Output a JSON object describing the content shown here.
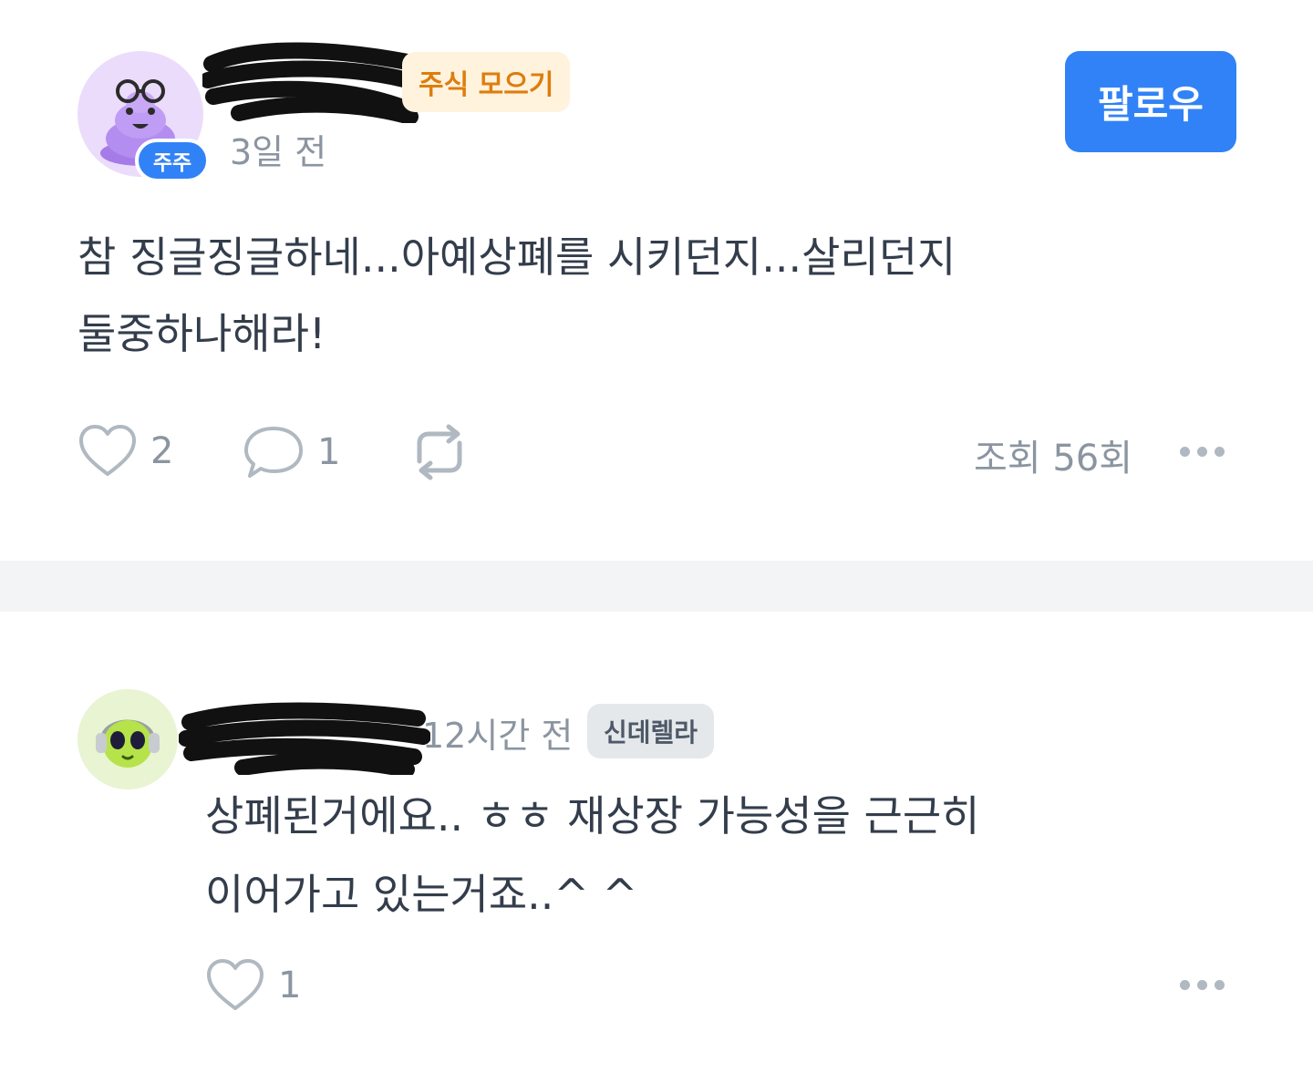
{
  "post": {
    "author": {
      "level_badge": "주주",
      "tag": "주식 모으기"
    },
    "time": "3일 전",
    "follow_label": "팔로우",
    "body_lines": [
      "참 징글징글하네...아예상폐를 시키던지...살리던지",
      "둘중하나해라!"
    ],
    "actions": {
      "like_count": "2",
      "comment_count": "1",
      "views": "조회 56회"
    },
    "icons": [
      "heart-icon",
      "comment-icon",
      "repost-icon",
      "more-icon"
    ]
  },
  "comment": {
    "time": "12시간 전",
    "tag": "신데렐라",
    "body_lines": [
      "상폐된거에요.. ㅎㅎ  재상장 가능성을 근근히",
      "이어가고 있는거죠..^ ^"
    ],
    "like_count": "1"
  },
  "colors": {
    "accent": "#3182f6",
    "text": "#333d4b",
    "muted": "#8b95a1",
    "tag_orange_bg": "#fff3de",
    "tag_orange_text": "#de7d0d",
    "divider": "#f2f4f6"
  }
}
